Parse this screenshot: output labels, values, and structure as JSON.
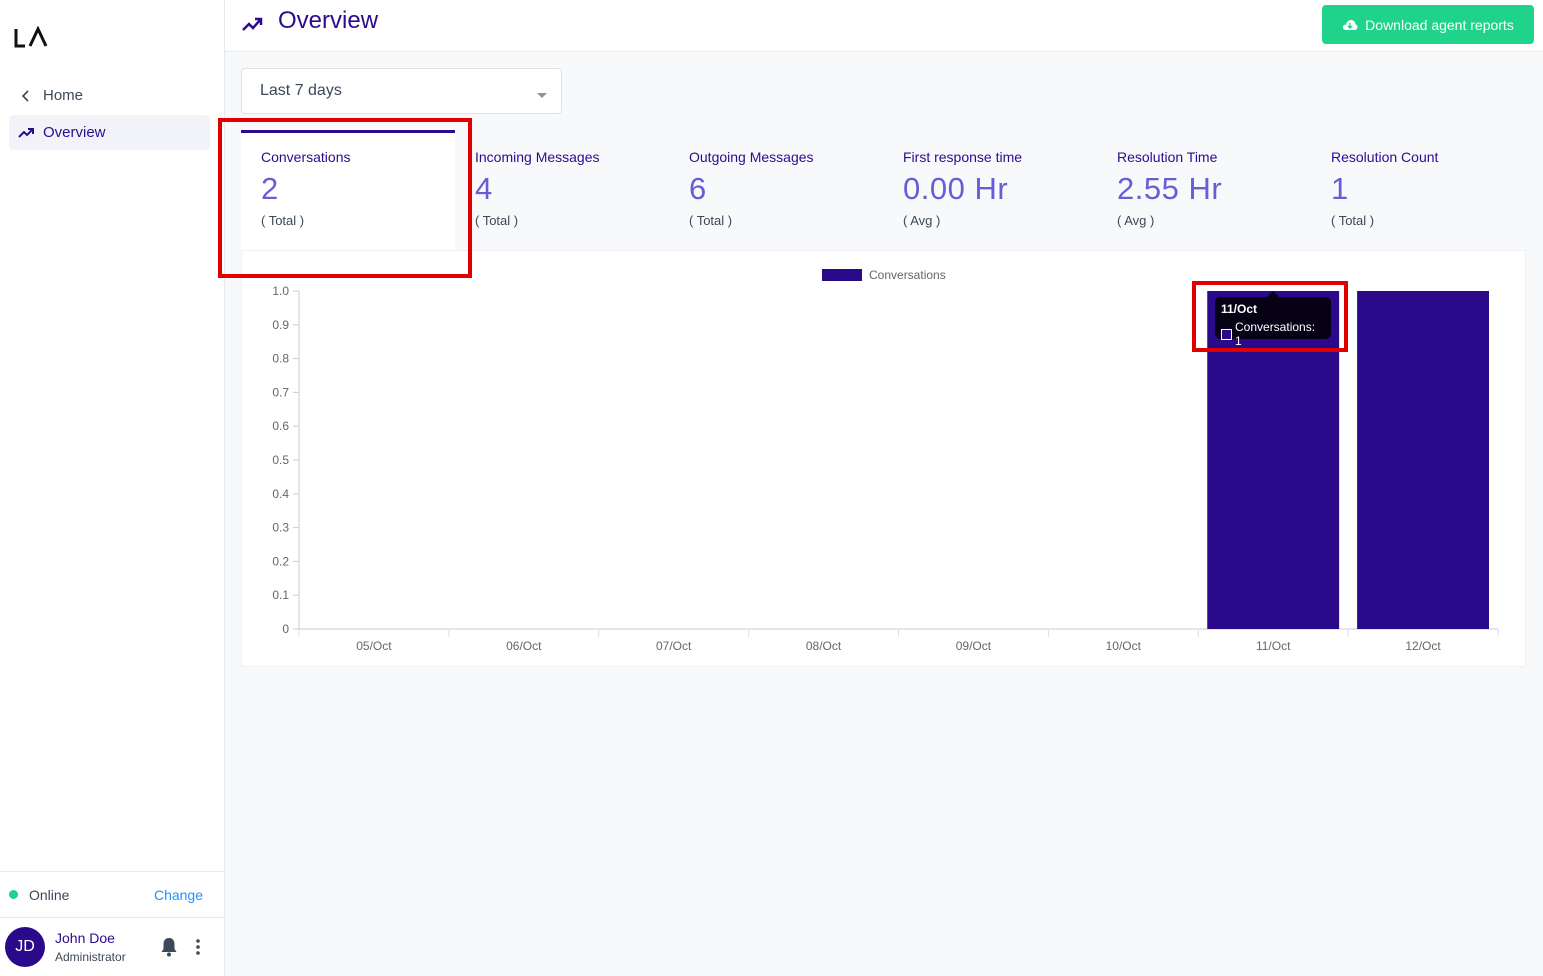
{
  "sidebar": {
    "logo_text": "LA",
    "nav": [
      {
        "label": "Home",
        "icon": "chevron-left-icon"
      },
      {
        "label": "Overview",
        "icon": "trending-up-icon"
      }
    ],
    "status": {
      "label": "Online",
      "action": "Change",
      "color": "#1fd38a"
    },
    "user": {
      "initials": "JD",
      "name": "John Doe",
      "role": "Administrator"
    }
  },
  "header": {
    "title": "Overview",
    "download_label": "Download agent reports",
    "accent": "#1fd38a",
    "brand": "#2d0b8f"
  },
  "filter": {
    "range_value": "Last 7 days"
  },
  "metrics": [
    {
      "title": "Conversations",
      "value": "2",
      "sub": "( Total )"
    },
    {
      "title": "Incoming Messages",
      "value": "4",
      "sub": "( Total )"
    },
    {
      "title": "Outgoing Messages",
      "value": "6",
      "sub": "( Total )"
    },
    {
      "title": "First response time",
      "value": "0.00 Hr",
      "sub": "( Avg )"
    },
    {
      "title": "Resolution Time",
      "value": "2.55 Hr",
      "sub": "( Avg )"
    },
    {
      "title": "Resolution Count",
      "value": "1",
      "sub": "( Total )"
    }
  ],
  "tooltip": {
    "title": "11/Oct",
    "line": "Conversations: 1"
  },
  "chart_data": {
    "type": "bar",
    "categories": [
      "05/Oct",
      "06/Oct",
      "07/Oct",
      "08/Oct",
      "09/Oct",
      "10/Oct",
      "11/Oct",
      "12/Oct"
    ],
    "series": [
      {
        "name": "Conversations",
        "values": [
          0,
          0,
          0,
          0,
          0,
          0,
          1,
          1
        ],
        "color": "#2a0a8b"
      }
    ],
    "yticks": [
      "0",
      "0.1",
      "0.2",
      "0.3",
      "0.4",
      "0.5",
      "0.6",
      "0.7",
      "0.8",
      "0.9",
      "1.0"
    ],
    "ylim": [
      0,
      1.0
    ],
    "legend": "top-center",
    "grid": false
  }
}
